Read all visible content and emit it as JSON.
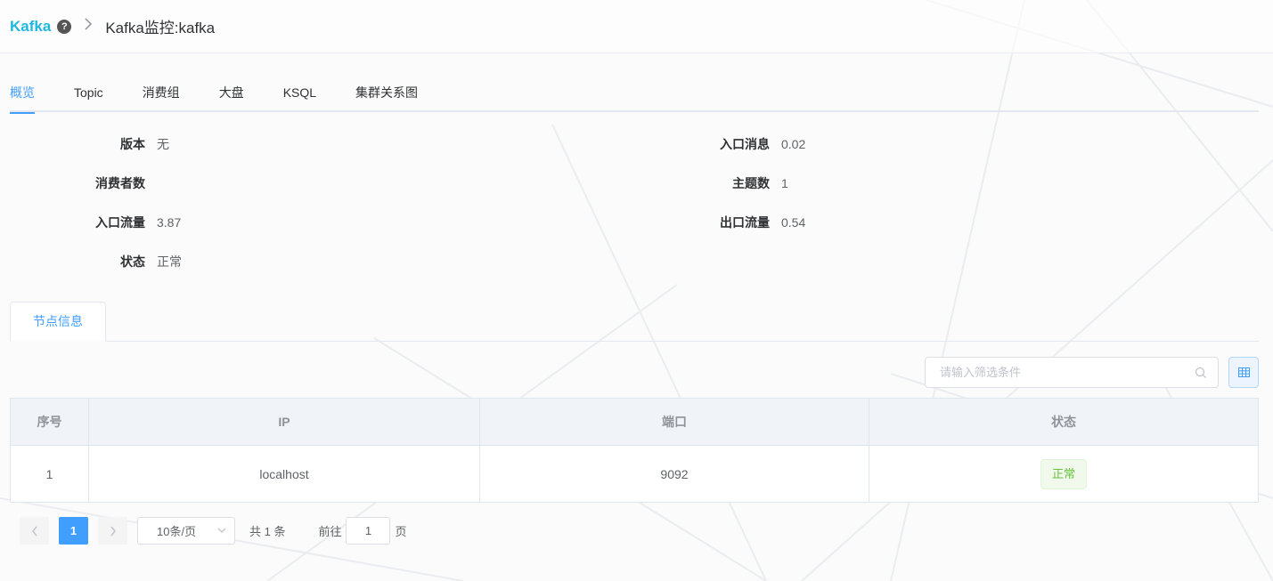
{
  "header": {
    "brand": "Kafka",
    "title": "Kafka监控:kafka"
  },
  "tabs": [
    {
      "label": "概览",
      "active": true
    },
    {
      "label": "Topic",
      "active": false
    },
    {
      "label": "消费组",
      "active": false
    },
    {
      "label": "大盘",
      "active": false
    },
    {
      "label": "KSQL",
      "active": false
    },
    {
      "label": "集群关系图",
      "active": false
    }
  ],
  "overview": {
    "version": {
      "label": "版本",
      "value": "无"
    },
    "consumers": {
      "label": "消费者数",
      "value": ""
    },
    "in_traffic": {
      "label": "入口流量",
      "value": "3.87"
    },
    "status": {
      "label": "状态",
      "value": "正常"
    },
    "in_messages": {
      "label": "入口消息",
      "value": "0.02"
    },
    "topics": {
      "label": "主题数",
      "value": "1"
    },
    "out_traffic": {
      "label": "出口流量",
      "value": "0.54"
    }
  },
  "node_tab": {
    "label": "节点信息"
  },
  "search": {
    "placeholder": "请输入筛选条件"
  },
  "table": {
    "headers": [
      "序号",
      "IP",
      "端口",
      "状态"
    ],
    "rows": [
      {
        "index": "1",
        "ip": "localhost",
        "port": "9092",
        "status": "正常"
      }
    ]
  },
  "pagination": {
    "current_page": "1",
    "page_size": "10条/页",
    "total": "共 1 条",
    "goto_label": "前往",
    "goto_value": "1",
    "page_suffix": "页"
  },
  "colors": {
    "brand": "#1fb8e0",
    "accent": "#409eff",
    "success": "#67c23a"
  }
}
